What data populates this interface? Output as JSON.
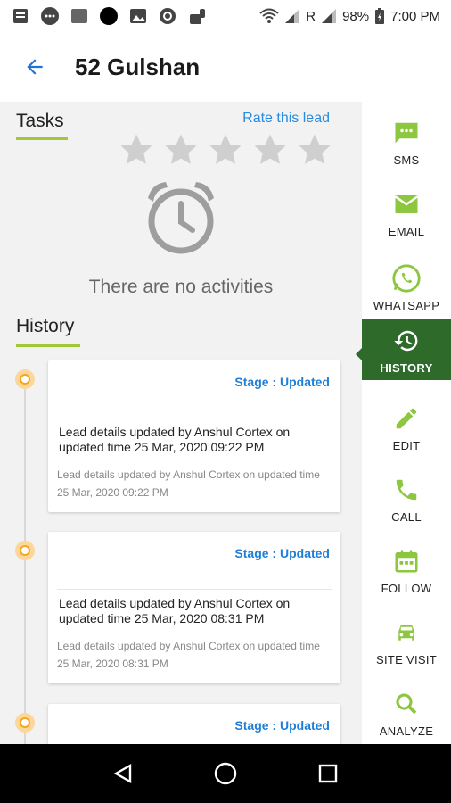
{
  "status_bar": {
    "battery": "98%",
    "time": "7:00 PM",
    "carrier": "R"
  },
  "app_bar": {
    "title": "52 Gulshan"
  },
  "tasks": {
    "title": "Tasks",
    "rate_label": "Rate this lead",
    "rating": 0,
    "empty_text": "There are no activities"
  },
  "history": {
    "title": "History",
    "entries": [
      {
        "stage": "Stage : Updated",
        "description": "Lead details updated by Anshul Cortex on updated time 25 Mar, 2020 09:22 PM",
        "detail": "Lead details updated by Anshul Cortex on updated time 25 Mar, 2020 09:22 PM"
      },
      {
        "stage": "Stage : Updated",
        "description": "Lead details updated by Anshul Cortex on updated time 25 Mar, 2020 08:31 PM",
        "detail": "Lead details updated by Anshul Cortex on updated time 25 Mar, 2020 08:31 PM"
      },
      {
        "stage": "Stage : Updated",
        "description": "",
        "detail": ""
      }
    ]
  },
  "rail": {
    "items": [
      {
        "label": "SMS",
        "icon": "sms-icon"
      },
      {
        "label": "EMAIL",
        "icon": "email-icon"
      },
      {
        "label": "WHATSAPP",
        "icon": "whatsapp-icon"
      },
      {
        "label": "HISTORY",
        "icon": "history-icon",
        "active": true
      },
      {
        "label": "EDIT",
        "icon": "edit-icon"
      },
      {
        "label": "CALL",
        "icon": "call-icon"
      },
      {
        "label": "FOLLOW",
        "icon": "calendar-icon"
      },
      {
        "label": "SITE VISIT",
        "icon": "car-icon"
      },
      {
        "label": "ANALYZE",
        "icon": "search-icon"
      }
    ]
  },
  "colors": {
    "accent_green": "#8dc63f",
    "active_green": "#2e6b2b",
    "link_blue": "#2a8be0",
    "timeline_orange": "#f5a623"
  }
}
